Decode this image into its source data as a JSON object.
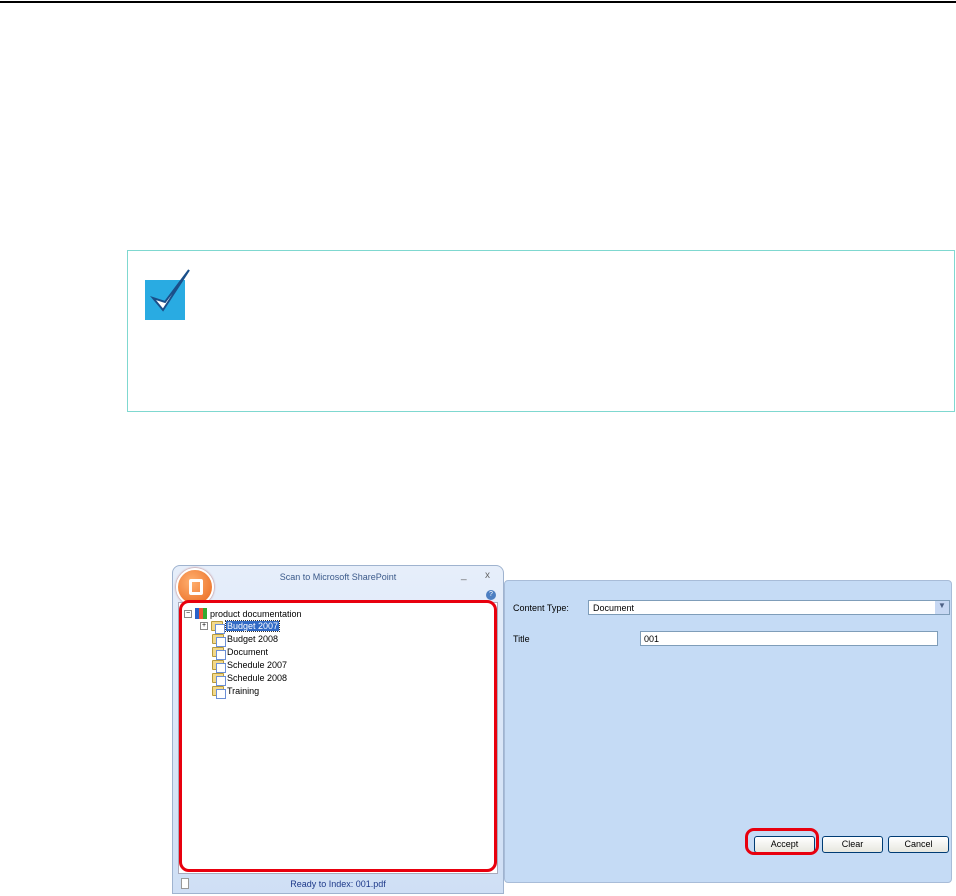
{
  "dialog": {
    "title": "Scan to Microsoft SharePoint",
    "minimize": "_",
    "close": "x",
    "help": "?",
    "tree": {
      "root": "product documentation",
      "items": [
        "Budget 2007",
        "Budget 2008",
        "Document",
        "Schedule 2007",
        "Schedule 2008",
        "Training"
      ]
    },
    "status": "Ready to Index: 001.pdf"
  },
  "form": {
    "content_type_label": "Content Type:",
    "content_type_value": "Document",
    "title_label": "Title",
    "title_value": "001",
    "accept": "Accept",
    "clear": "Clear",
    "cancel": "Cancel"
  }
}
